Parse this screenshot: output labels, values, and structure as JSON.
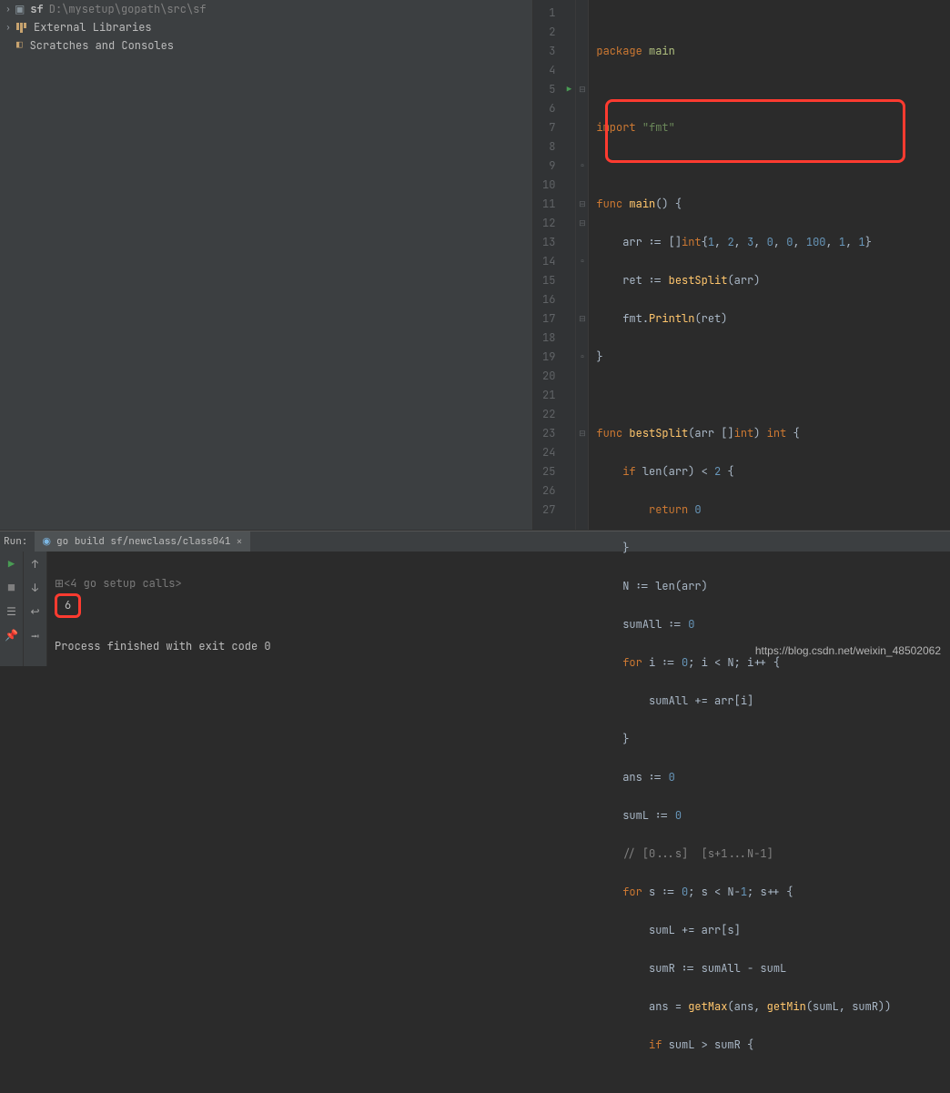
{
  "project": {
    "root_name": "sf",
    "root_path": "D:\\mysetup\\gopath\\src\\sf",
    "external_libs": "External Libraries",
    "scratches": "Scratches and Consoles"
  },
  "editor": {
    "line_numbers": [
      "1",
      "2",
      "3",
      "4",
      "5",
      "6",
      "7",
      "8",
      "9",
      "10",
      "11",
      "12",
      "13",
      "14",
      "15",
      "16",
      "17",
      "18",
      "19",
      "20",
      "21",
      "22",
      "23",
      "24",
      "25",
      "26",
      "27"
    ],
    "code": {
      "l1_kw": "package",
      "l1_pkg": "main",
      "l3_kw": "import",
      "l3_str": "\"fmt\"",
      "l5_kw": "func",
      "l5_fn": "main",
      "l6_a": "arr := []",
      "l6_ty": "int",
      "l6_nums": "{1, 2, 3, 0, 0, 100, 1, 1}",
      "l6_n1": "1",
      "l6_n2": "2",
      "l6_n3": "3",
      "l6_n4": "0",
      "l6_n5": "0",
      "l6_n6": "100",
      "l6_n7": "1",
      "l6_n8": "1",
      "l7_a": "ret := ",
      "l7_fn": "bestSplit",
      "l7_b": "(arr)",
      "l8_a": "fmt.",
      "l8_fn": "Println",
      "l8_b": "(ret)",
      "l11_kw": "func",
      "l11_fn": "bestSplit",
      "l11_sig_a": "(arr []",
      "l11_ty": "int",
      "l11_sig_b": ") ",
      "l11_ret_ty": "int",
      "l11_sig_c": " {",
      "l12_kw": "if",
      "l12_a": " len(arr) < ",
      "l12_n": "2",
      "l12_b": " {",
      "l13_kw": "return",
      "l13_n": "0",
      "l15_a": "N := len(arr)",
      "l16_a": "sumAll := ",
      "l16_n": "0",
      "l17_kw": "for",
      "l17_a": " i := ",
      "l17_n0": "0",
      "l17_b": "; i < N; i++ {",
      "l18_a": "sumAll += arr[i]",
      "l20_a": "ans := ",
      "l20_n": "0",
      "l21_a": "sumL := ",
      "l21_n": "0",
      "l22_cmt": "// [0...s]  [s+1...N-1]",
      "l23_kw": "for",
      "l23_a": " s := ",
      "l23_n0": "0",
      "l23_b": "; s < N-",
      "l23_n1": "1",
      "l23_c": "; s++ {",
      "l24_a": "sumL += arr[s]",
      "l25_a": "sumR := sumAll - sumL",
      "l26_a": "ans = ",
      "l26_fn1": "getMax",
      "l26_b": "(ans, ",
      "l26_fn2": "getMin",
      "l26_c": "(sumL, sumR))",
      "l27_kw": "if",
      "l27_a": " sumL > sumR {"
    }
  },
  "run": {
    "title": "Run:",
    "tab_label": "go build sf/newclass/class041",
    "setup_calls": "<4 go setup calls>",
    "result": "6",
    "exit_msg": "Process finished with exit code 0"
  },
  "watermark": "https://blog.csdn.net/weixin_48502062"
}
